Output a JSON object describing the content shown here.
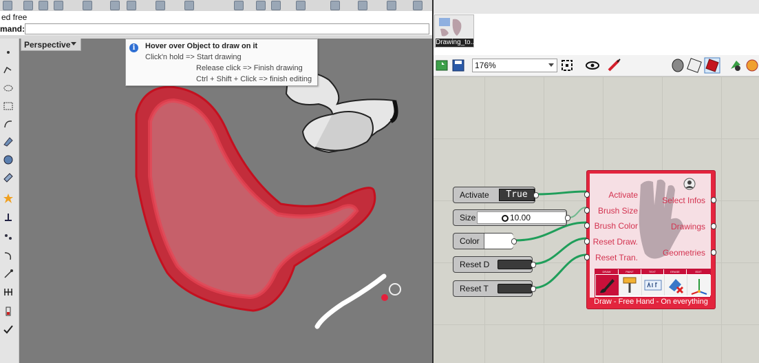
{
  "rhino": {
    "history_text": "ed free",
    "command_label": "mand:",
    "command_value": "",
    "viewport_title": "Perspective"
  },
  "tooltip": {
    "title": "Hover over Object to draw on it",
    "lines": [
      "Click'n hold => Start drawing",
      "Release click => Finish drawing",
      "Ctrl + Shift + Click => finish editing"
    ]
  },
  "grasshopper": {
    "tab_tile_label": "Drawing_to...",
    "zoom": "176%",
    "params": {
      "activate": {
        "label": "Activate",
        "value": "True"
      },
      "size": {
        "label": "Size",
        "value": "10.00"
      },
      "color": {
        "label": "Color",
        "value": ""
      },
      "reset_d": {
        "label": "Reset D"
      },
      "reset_t": {
        "label": "Reset T"
      }
    },
    "component": {
      "inputs": [
        "Activate",
        "Brush Size",
        "Brush Color",
        "Reset Draw.",
        "Reset Tran."
      ],
      "outputs": [
        "Select Infos",
        "Drawings",
        "Geometries"
      ],
      "tools": [
        "DRAW",
        "PAINT",
        "TEXT",
        "ERASE",
        "EDIT"
      ],
      "footer": "Draw - Free Hand - On everything"
    }
  },
  "colors": {
    "component_red": "#e3253e",
    "wire_green": "#1f9e5a",
    "shape_red": "#d61a2c",
    "viewport_gray": "#7b7b7b"
  },
  "icons": {
    "tooltip": "info-icon",
    "zoom_toggle": "chevron-down-icon"
  }
}
